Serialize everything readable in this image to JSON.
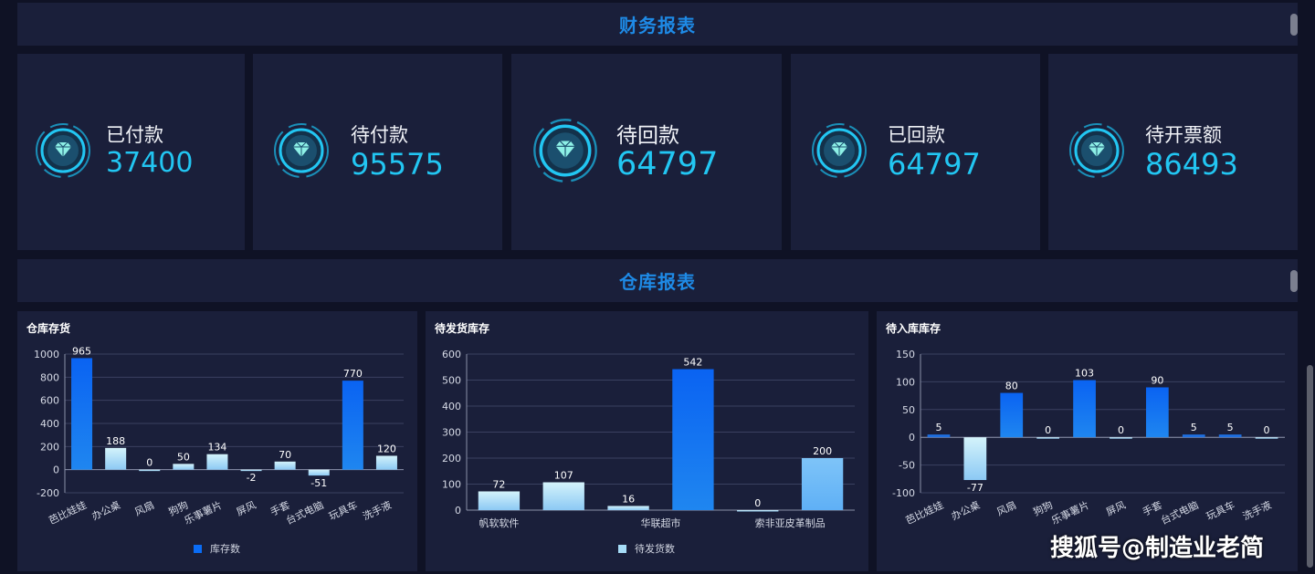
{
  "finance_header": {
    "title": "财务报表"
  },
  "warehouse_header": {
    "title": "仓库报表"
  },
  "cards": [
    {
      "label": "已付款",
      "value": "37400",
      "icon": "diamond-icon"
    },
    {
      "label": "待付款",
      "value": "95575",
      "icon": "diamond-icon"
    },
    {
      "label": "待回款",
      "value": "64797",
      "icon": "diamond-icon"
    },
    {
      "label": "已回款",
      "value": "64797",
      "icon": "diamond-icon"
    },
    {
      "label": "待开票额",
      "value": "86493",
      "icon": "diamond-icon"
    }
  ],
  "colors": {
    "accent": "#1e8ae6",
    "value": "#22c6f2",
    "bg": "#0f1225",
    "panel": "#1a1f3a",
    "bar_blue": "#0a6cf5",
    "bar_light": "#a6dcf7"
  },
  "watermark": "搜狐号@制造业老简",
  "chart_data": [
    {
      "type": "bar",
      "title": "仓库存货",
      "categories": [
        "芭比娃娃",
        "办公桌",
        "风扇",
        "狗狗",
        "乐事薯片",
        "屏风",
        "手套",
        "台式电脑",
        "玩具车",
        "洗手液"
      ],
      "values": [
        965,
        188,
        0,
        50,
        134,
        -2,
        70,
        -51,
        770,
        120
      ],
      "series": [
        {
          "name": "库存数",
          "values": [
            965,
            188,
            0,
            50,
            134,
            -2,
            70,
            -51,
            770,
            120
          ]
        }
      ],
      "ylim": [
        -200,
        1000
      ],
      "yticks": [
        -200,
        0,
        200,
        400,
        600,
        800,
        1000
      ],
      "legend": "bottom"
    },
    {
      "type": "bar",
      "title": "待发货库存",
      "categories": [
        "帆软软件",
        "",
        "华联超市",
        "",
        "索非亚皮革制品",
        ""
      ],
      "values": [
        72,
        107,
        16,
        542,
        0,
        200
      ],
      "series": [
        {
          "name": "待发货数",
          "values": [
            72,
            107,
            16,
            542,
            0,
            200
          ]
        }
      ],
      "ylim": [
        0,
        600
      ],
      "yticks": [
        0,
        100,
        200,
        300,
        400,
        500,
        600
      ],
      "legend": "bottom"
    },
    {
      "type": "bar",
      "title": "待入库库存",
      "categories": [
        "芭比娃娃",
        "办公桌",
        "风扇",
        "狗狗",
        "乐事薯片",
        "屏风",
        "手套",
        "台式电脑",
        "玩具车",
        "洗手液"
      ],
      "values": [
        5,
        -77,
        80,
        0,
        103,
        0,
        90,
        5,
        5,
        0
      ],
      "ylim": [
        -100,
        150
      ],
      "yticks": [
        -100,
        -50,
        0,
        50,
        100,
        150
      ]
    }
  ]
}
